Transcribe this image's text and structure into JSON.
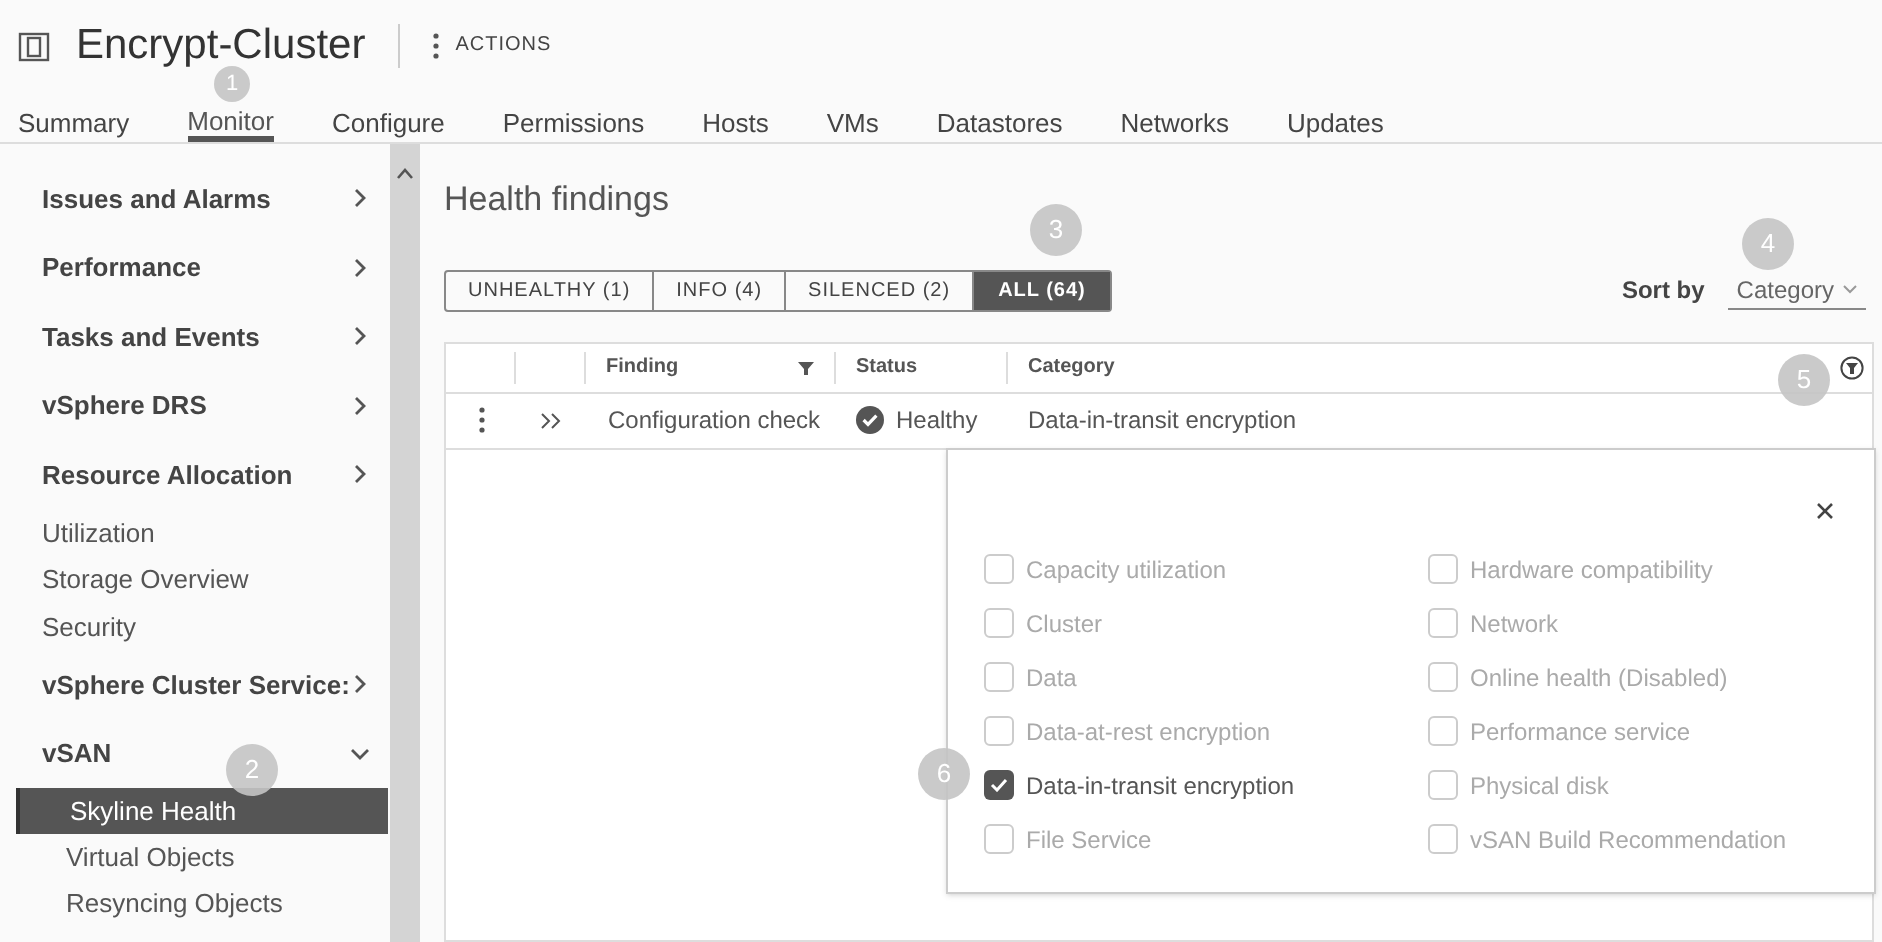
{
  "header": {
    "title": "Encrypt-Cluster",
    "actions": "ACTIONS"
  },
  "tabs": [
    {
      "label": "Summary",
      "selected": false
    },
    {
      "label": "Monitor",
      "selected": true
    },
    {
      "label": "Configure",
      "selected": false
    },
    {
      "label": "Permissions",
      "selected": false
    },
    {
      "label": "Hosts",
      "selected": false
    },
    {
      "label": "VMs",
      "selected": false
    },
    {
      "label": "Datastores",
      "selected": false
    },
    {
      "label": "Networks",
      "selected": false
    },
    {
      "label": "Updates",
      "selected": false
    }
  ],
  "sidebar": {
    "items": [
      {
        "kind": "section",
        "label": "Issues and Alarms",
        "expanded": false
      },
      {
        "kind": "section",
        "label": "Performance",
        "expanded": false
      },
      {
        "kind": "section",
        "label": "Tasks and Events",
        "expanded": false
      },
      {
        "kind": "section",
        "label": "vSphere DRS",
        "expanded": false
      },
      {
        "kind": "section",
        "label": "Resource Allocation",
        "expanded": false
      },
      {
        "kind": "link",
        "label": "Utilization"
      },
      {
        "kind": "link",
        "label": "Storage Overview"
      },
      {
        "kind": "link",
        "label": "Security"
      },
      {
        "kind": "section",
        "label": "vSphere Cluster Service:",
        "expanded": false
      },
      {
        "kind": "section",
        "label": "vSAN",
        "expanded": true,
        "children": [
          {
            "label": "Skyline Health",
            "selected": true
          },
          {
            "label": "Virtual Objects",
            "selected": false
          },
          {
            "label": "Resyncing Objects",
            "selected": false
          }
        ]
      }
    ]
  },
  "content": {
    "title": "Health findings",
    "filters": [
      {
        "label": "UNHEALTHY (1)",
        "selected": false
      },
      {
        "label": "INFO (4)",
        "selected": false
      },
      {
        "label": "SILENCED (2)",
        "selected": false
      },
      {
        "label": "ALL (64)",
        "selected": true
      }
    ],
    "sort": {
      "label": "Sort by",
      "value": "Category"
    },
    "table": {
      "columns": [
        "Finding",
        "Status",
        "Category"
      ],
      "rows": [
        {
          "finding": "Configuration check",
          "status": "Healthy",
          "category": "Data-in-transit encryption"
        }
      ]
    },
    "category_filter": {
      "options": [
        {
          "label": "Capacity utilization",
          "checked": false
        },
        {
          "label": "Cluster",
          "checked": false
        },
        {
          "label": "Data",
          "checked": false
        },
        {
          "label": "Data-at-rest encryption",
          "checked": false
        },
        {
          "label": "Data-in-transit encryption",
          "checked": true
        },
        {
          "label": "File Service",
          "checked": false
        },
        {
          "label": "Hardware compatibility",
          "checked": false
        },
        {
          "label": "Network",
          "checked": false
        },
        {
          "label": "Online health (Disabled)",
          "checked": false
        },
        {
          "label": "Performance service",
          "checked": false
        },
        {
          "label": "Physical disk",
          "checked": false
        },
        {
          "label": "vSAN Build Recommendation",
          "checked": false
        }
      ]
    }
  },
  "callouts": [
    "1",
    "2",
    "3",
    "4",
    "5",
    "6"
  ]
}
